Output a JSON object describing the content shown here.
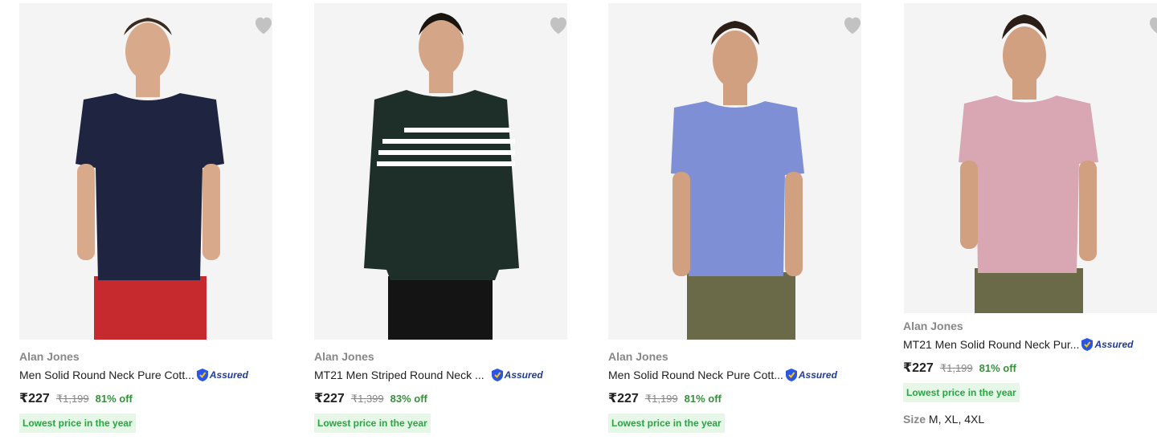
{
  "products": [
    {
      "brand": "Alan Jones",
      "title": "Men Solid Round Neck Pure Cott...",
      "assured": "Assured",
      "price": "₹227",
      "mrp": "₹1,199",
      "discount": "81% off",
      "badge": "Lowest price in the year",
      "shirt_color": "#1f2540",
      "pants_color": "#c62a2f"
    },
    {
      "brand": "Alan Jones",
      "title": "MT21 Men Striped Round Neck ...",
      "assured": "Assured",
      "price": "₹227",
      "mrp": "₹1,399",
      "discount": "83% off",
      "badge": "Lowest price in the year",
      "shirt_color": "#1e2e28",
      "pants_color": "#141414"
    },
    {
      "brand": "Alan Jones",
      "title": "Men Solid Round Neck Pure Cott...",
      "assured": "Assured",
      "price": "₹227",
      "mrp": "₹1,199",
      "discount": "81% off",
      "badge": "Lowest price in the year",
      "shirt_color": "#7f8fd6",
      "pants_color": "#6b6a48"
    },
    {
      "brand": "Alan Jones",
      "title": "MT21 Men Solid Round Neck Pur...",
      "assured": "Assured",
      "price": "₹227",
      "mrp": "₹1,199",
      "discount": "81% off",
      "badge": "Lowest price in the year",
      "size_label": "Size",
      "sizes": "M, XL, 4XL",
      "shirt_color": "#d9a7b4",
      "pants_color": "#6b6a48"
    }
  ],
  "icons": {
    "wishlist": "heart-icon",
    "assured": "assured-shield-icon"
  },
  "colors": {
    "discount_green": "#388e3c",
    "badge_bg": "#e6f7e8",
    "badge_text": "#26a541",
    "assured_blue": "#1f3b95"
  }
}
